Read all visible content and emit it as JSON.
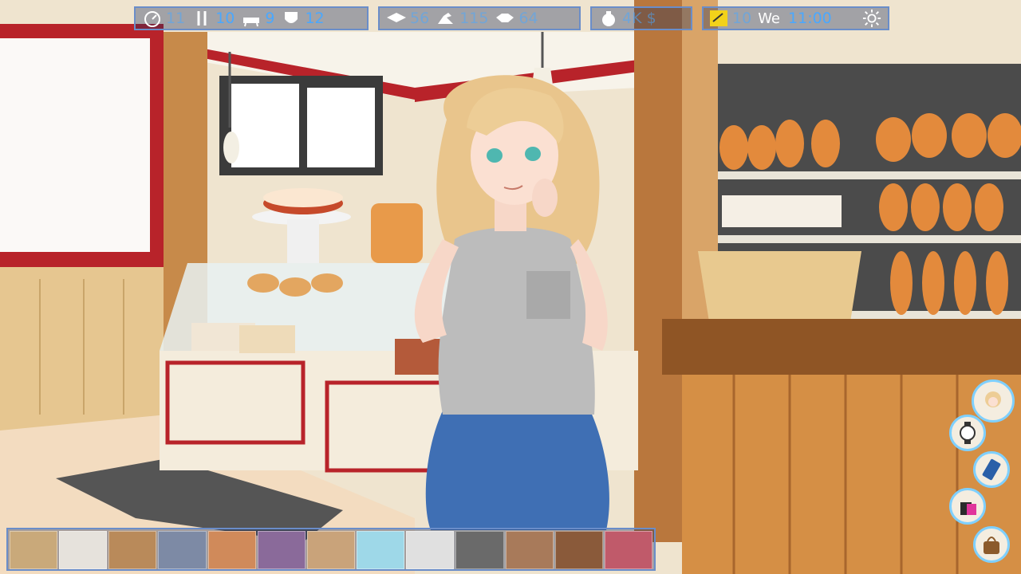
{
  "hud": {
    "energy": "11",
    "food": "10",
    "hygiene": "9",
    "mood": "12",
    "intelligence": "56",
    "fitness": "115",
    "charisma": "64",
    "money": "4K $",
    "day": "10",
    "weekday": "We",
    "time": "11:00"
  },
  "icons": {
    "energy": "gauge-icon",
    "food": "fork-knife-icon",
    "hygiene": "bathtub-icon",
    "mood": "mask-icon",
    "intelligence": "graduation-cap-icon",
    "fitness": "flexed-arm-icon",
    "charisma": "handshake-icon",
    "money": "money-bag-icon",
    "calendar": "notepad-icon",
    "weather": "sun-icon"
  },
  "side_buttons": [
    "character-portrait-icon",
    "watch-icon",
    "phone-icon",
    "shopping-bag-icon",
    "handbag-icon"
  ],
  "location_thumbnails": 13,
  "colors": {
    "hud_text": "#4aa8ff",
    "hud_border": "#6a8dc9",
    "side_border": "#7fd0ff"
  }
}
